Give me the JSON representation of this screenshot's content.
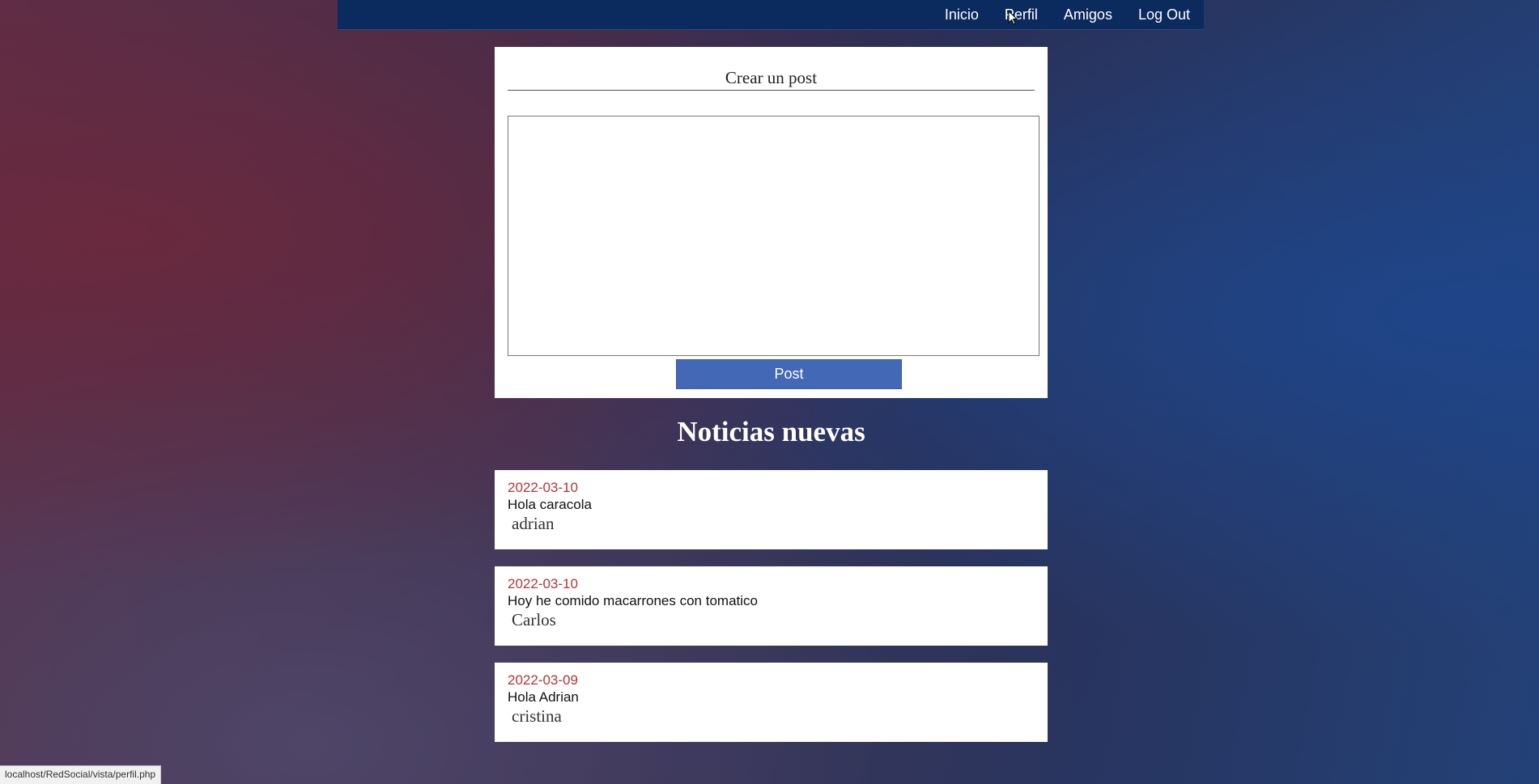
{
  "nav": {
    "items": [
      {
        "label": "Inicio"
      },
      {
        "label": "Perfil"
      },
      {
        "label": "Amigos"
      },
      {
        "label": "Log Out"
      }
    ]
  },
  "create_post": {
    "title": "Crear un post",
    "textarea_value": "",
    "button_label": "Post"
  },
  "news": {
    "heading": "Noticias nuevas",
    "items": [
      {
        "date": "2022-03-10",
        "text": "Hola caracola",
        "author": "adrian"
      },
      {
        "date": "2022-03-10",
        "text": "Hoy he comido macarrones con tomatico",
        "author": "Carlos"
      },
      {
        "date": "2022-03-09",
        "text": "Hola Adrian",
        "author": "cristina"
      }
    ]
  },
  "status_bar": {
    "url": "localhost/RedSocial/vista/perfil.php"
  },
  "colors": {
    "navbar_bg": "#0b2a5e",
    "button_bg": "#4368b5",
    "date_color": "#b23535"
  }
}
